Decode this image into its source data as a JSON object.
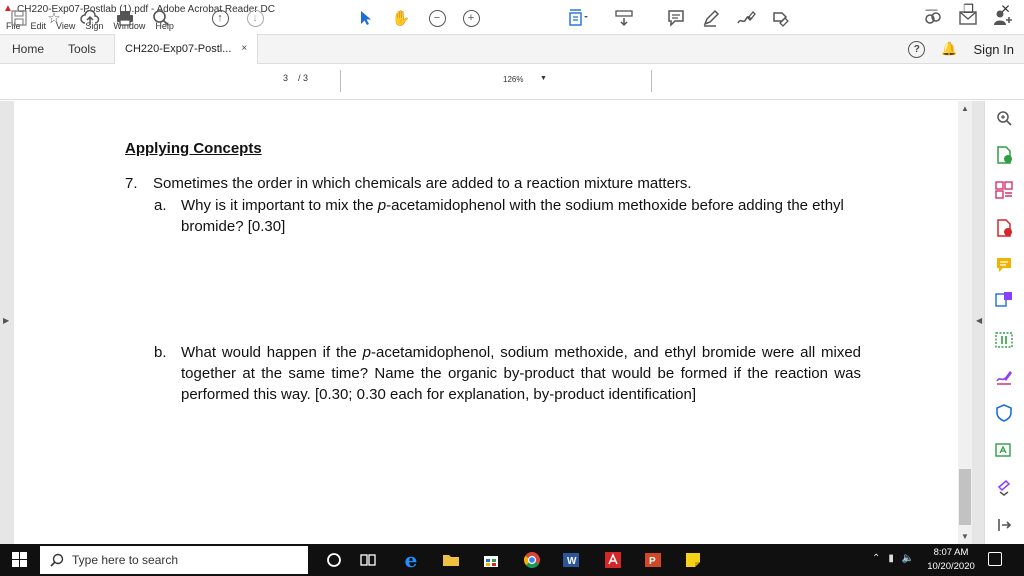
{
  "window": {
    "title": "CH220-Exp07-Postlab (1).pdf - Adobe Acrobat Reader DC",
    "minimize": "—",
    "restore": "❐",
    "close": "✕"
  },
  "menu": [
    "File",
    "Edit",
    "View",
    "Sign",
    "Window",
    "Help"
  ],
  "tabs": {
    "home": "Home",
    "tools": "Tools",
    "document": "CH220-Exp07-Postl...",
    "close": "×",
    "help": "?",
    "sign_in": "Sign In"
  },
  "toolbar": {
    "page_current": "3",
    "page_total": "/ 3",
    "zoom": "126%"
  },
  "document": {
    "heading": "Applying Concepts",
    "question_number": "7.",
    "question_text": "Sometimes the order in which chemicals are added to a reaction mixture matters.",
    "parts": [
      {
        "label": "a.",
        "text": "Why is it important to mix the p-acetamidophenol with the sodium methoxide before adding the ethyl bromide?  [0.30]"
      },
      {
        "label": "b.",
        "text": "What would happen if the p-acetamidophenol, sodium methoxide, and ethyl bromide were all mixed together at the same time?  Name the organic by-product that would be formed if the reaction was performed this way.   [0.30; 0.30 each for explanation, by-product identification]"
      }
    ]
  },
  "taskbar": {
    "search_placeholder": "Type here to search",
    "time": "8:07 AM",
    "date": "10/20/2020"
  },
  "colors": {
    "acrobat_red": "#d4272b",
    "tool_blue": "#1d6fd6",
    "sidebar_green": "#2f9e44",
    "sidebar_pink": "#d6336c",
    "sidebar_yellow": "#f0b400",
    "sidebar_purple": "#8a3ffc",
    "taskbar_bg": "#101010"
  }
}
